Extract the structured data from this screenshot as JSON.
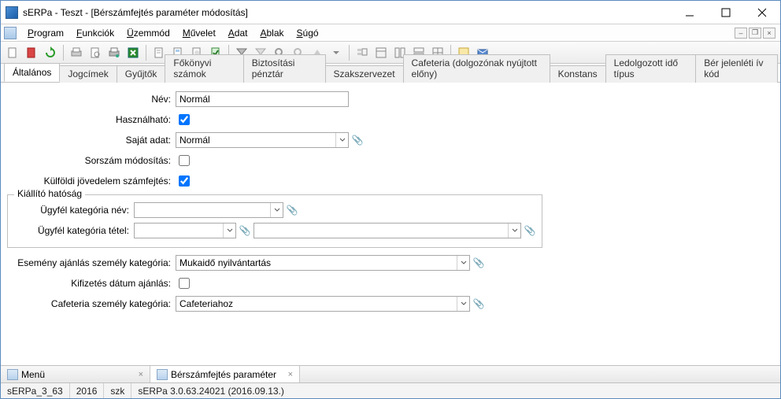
{
  "window": {
    "title": "sERPa - Teszt - [Bérszámfejtés paraméter módosítás]"
  },
  "menu": {
    "program": "Program",
    "funkciok": "Funkciók",
    "uzemmod": "Üzemmód",
    "muvelet": "Művelet",
    "adat": "Adat",
    "ablak": "Ablak",
    "sugo": "Súgó"
  },
  "tabs": {
    "altalanos": "Általános",
    "jogcimek": "Jogcímek",
    "gyujtok": "Gyűjtők",
    "fokonyvi": "Főkönyvi számok",
    "biztositasi": "Biztosítási pénztár",
    "szakszervezet": "Szakszervezet",
    "cafeteria": "Cafeteria (dolgozónak nyújtott előny)",
    "konstans": "Konstans",
    "ledolgozott": "Ledolgozott idő típus",
    "berjelenleti": "Bér jelenléti ív kód"
  },
  "form": {
    "nev_label": "Név:",
    "nev_value": "Normál",
    "hasznalhato_label": "Használható:",
    "hasznalhato_checked": true,
    "sajat_adat_label": "Saját adat:",
    "sajat_adat_value": "Normál",
    "sorszam_label": "Sorszám módosítás:",
    "sorszam_checked": false,
    "kulfoldi_label": "Külföldi jövedelem számfejtés:",
    "kulfoldi_checked": true,
    "group_legend": "Kiállító hatóság",
    "ugyf_kat_nev_label": "Ügyfél kategória név:",
    "ugyf_kat_nev_value": "",
    "ugyf_kat_tetel_label": "Ügyfél kategória tétel:",
    "ugyf_kat_tetel1_value": "",
    "ugyf_kat_tetel2_value": "",
    "esemeny_label": "Esemény ajánlás személy kategória:",
    "esemeny_value": "Mukaidő nyilvántartás",
    "kifizetes_label": "Kifizetés dátum ajánlás:",
    "kifizetes_checked": false,
    "cafeteria_kat_label": "Cafeteria személy kategória:",
    "cafeteria_kat_value": "Cafeteriahoz"
  },
  "bottom": {
    "tab_menu": "Menü",
    "tab_param": "Bérszámfejtés paraméter"
  },
  "status": {
    "cell1": "sERPa_3_63",
    "cell2": "2016",
    "cell3": "szk",
    "cell4": "sERPa 3.0.63.24021 (2016.09.13.)"
  }
}
